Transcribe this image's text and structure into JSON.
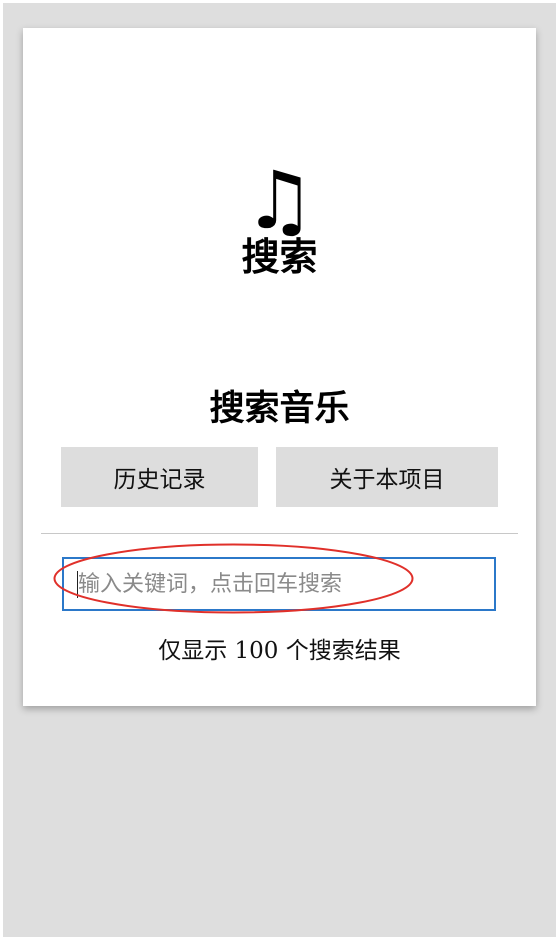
{
  "header": {
    "icon": "♫",
    "icon_name": "music-note-icon",
    "title": "搜索"
  },
  "main": {
    "section_title": "搜索音乐",
    "buttons": {
      "history": "历史记录",
      "about": "关于本项目"
    },
    "search": {
      "placeholder": "输入关键词，点击回车搜索",
      "value": ""
    },
    "result_note": "仅显示 100 个搜索结果"
  },
  "colors": {
    "background": "#dedede",
    "card": "#ffffff",
    "button": "#dddddd",
    "input_border": "#2b78c9",
    "annotation": "#e0302a"
  }
}
